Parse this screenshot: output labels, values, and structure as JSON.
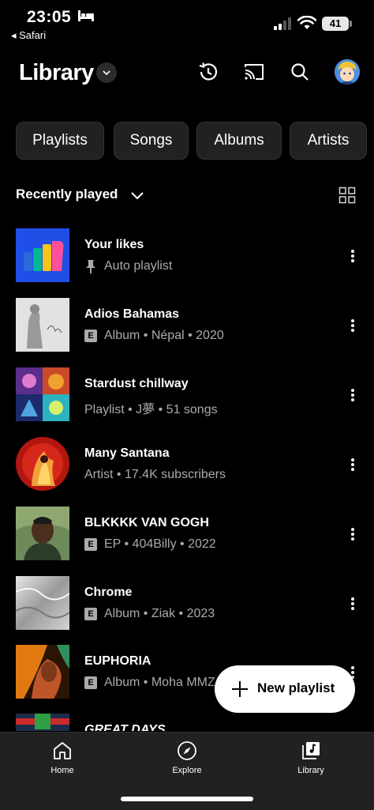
{
  "status_bar": {
    "time": "23:05",
    "back_app": "◂ Safari",
    "battery": "41"
  },
  "header": {
    "title": "Library"
  },
  "chips": [
    "Playlists",
    "Songs",
    "Albums",
    "Artists"
  ],
  "sort": {
    "label": "Recently played"
  },
  "items": [
    {
      "title": "Your likes",
      "subtitle": "Auto playlist",
      "explicit": false,
      "pinned": true,
      "round": false
    },
    {
      "title": "Adios Bahamas",
      "subtitle": "Album • Népal • 2020",
      "explicit": true,
      "pinned": false,
      "round": false
    },
    {
      "title": "Stardust chillway",
      "subtitle": "Playlist • J夢 • 51 songs",
      "explicit": false,
      "pinned": false,
      "round": false
    },
    {
      "title": "Many Santana",
      "subtitle": "Artist • 17.4K subscribers",
      "explicit": false,
      "pinned": false,
      "round": true
    },
    {
      "title": "BLKKKK VAN GOGH",
      "subtitle": "EP • 404Billy • 2022",
      "explicit": true,
      "pinned": false,
      "round": false
    },
    {
      "title": "Chrome",
      "subtitle": "Album • Ziak • 2023",
      "explicit": true,
      "pinned": false,
      "round": false
    },
    {
      "title": "EUPHORIA",
      "subtitle": "Album • Moha MMZ",
      "explicit": true,
      "pinned": false,
      "round": false
    },
    {
      "title": "GREAT DAYS",
      "subtitle": "",
      "explicit": false,
      "pinned": false,
      "round": false
    }
  ],
  "fab": {
    "label": "New playlist"
  },
  "nav": {
    "home": "Home",
    "explore": "Explore",
    "library": "Library"
  },
  "icons": {
    "header": [
      "history-icon",
      "cast-icon",
      "search-icon"
    ],
    "nav": [
      "home-icon",
      "compass-icon",
      "library-music-icon"
    ]
  }
}
